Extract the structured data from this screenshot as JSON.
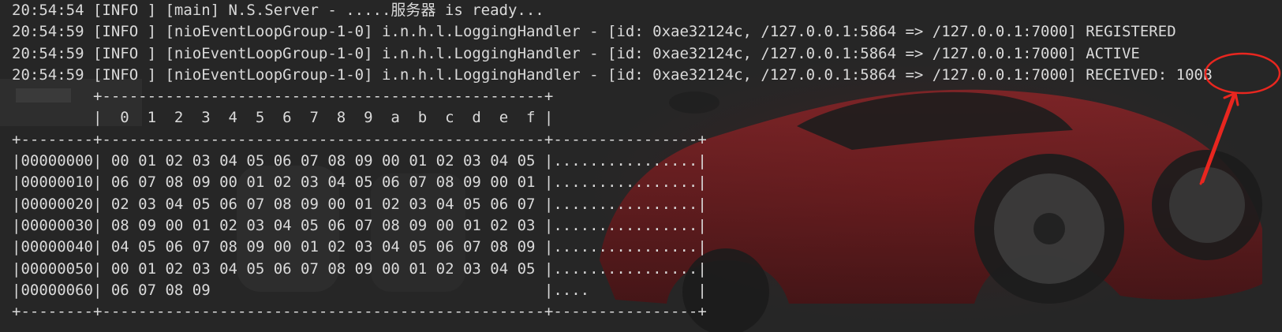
{
  "terminal": {
    "log_lines": [
      "20:54:54 [INFO ] [main] N.S.Server - .....服务器 is ready...",
      "20:54:59 [INFO ] [nioEventLoopGroup-1-0] i.n.h.l.LoggingHandler - [id: 0xae32124c, /127.0.0.1:5864 => /127.0.0.1:7000] REGISTERED",
      "20:54:59 [INFO ] [nioEventLoopGroup-1-0] i.n.h.l.LoggingHandler - [id: 0xae32124c, /127.0.0.1:5864 => /127.0.0.1:7000] ACTIVE",
      "20:54:59 [INFO ] [nioEventLoopGroup-1-0] i.n.h.l.LoggingHandler - [id: 0xae32124c, /127.0.0.1:5864 => /127.0.0.1:7000] RECEIVED: 100B"
    ],
    "hexdump_lines": [
      "         +-------------------------------------------------+",
      "         |  0  1  2  3  4  5  6  7  8  9  a  b  c  d  e  f |",
      "+--------+-------------------------------------------------+----------------+",
      "|00000000| 00 01 02 03 04 05 06 07 08 09 00 01 02 03 04 05 |................|",
      "|00000010| 06 07 08 09 00 01 02 03 04 05 06 07 08 09 00 01 |................|",
      "|00000020| 02 03 04 05 06 07 08 09 00 01 02 03 04 05 06 07 |................|",
      "|00000030| 08 09 00 01 02 03 04 05 06 07 08 09 00 01 02 03 |................|",
      "|00000040| 04 05 06 07 08 09 00 01 02 03 04 05 06 07 08 09 |................|",
      "|00000050| 00 01 02 03 04 05 06 07 08 09 00 01 02 03 04 05 |................|",
      "|00000060| 06 07 08 09                                     |....            |",
      "+--------+-------------------------------------------------+----------------+"
    ]
  },
  "colors": {
    "background": "#262626",
    "text": "#dadada",
    "annotation": "#e8261f",
    "car_red": "#7a1c1e"
  },
  "annotation": {
    "icon": "red-circle-and-arrow"
  }
}
